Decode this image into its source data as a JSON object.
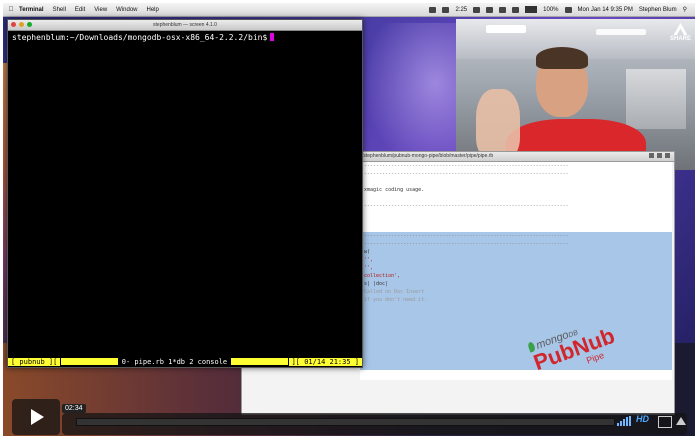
{
  "menubar": {
    "apple": "",
    "items": [
      "Terminal",
      "Shell",
      "Edit",
      "View",
      "Window",
      "Help"
    ],
    "status": {
      "time1": "2:25",
      "battery": "100%",
      "datetime": "Mon Jan 14  9:35 PM",
      "user": "Stephen Blum"
    }
  },
  "terminal": {
    "title": "stephenblum — screen 4.1.0",
    "prompt": "stephenblum:~/Downloads/mongodb-osx-x86_64-2.2.2/bin$",
    "status_left": "[ pubnub ][",
    "windows": "0- pipe.rb   1*db   2 console",
    "status_right": "][ 01/14 21:35 ]"
  },
  "webcam": {
    "share_label": "SHARE"
  },
  "browser": {
    "url": "/stephenblum/pubnub-mongo-pipe/blob/master/pipe/pipe.rb",
    "lines": [
      "--------------------------------------------------------------------",
      "--------------------------------------------------------------------",
      "",
      "xmagic coding usage.",
      "",
      "--------------------------------------------------------------------"
    ],
    "sel_lines": [
      "--------------------------------------------------------------------",
      "--------------------------------------------------------------------",
      "w(",
      "'',",
      "'',",
      "collection',",
      "s| |doc|",
      "  Called on Doc Insert",
      "  if you don't need it."
    ],
    "tilde": "~"
  },
  "logo": {
    "mongo": "mongo",
    "db": "DB",
    "pubnub": "PubNub",
    "pipe": "Pipe"
  },
  "player": {
    "current_time": "02:34",
    "progress": 0.0,
    "hd_label": "HD"
  }
}
